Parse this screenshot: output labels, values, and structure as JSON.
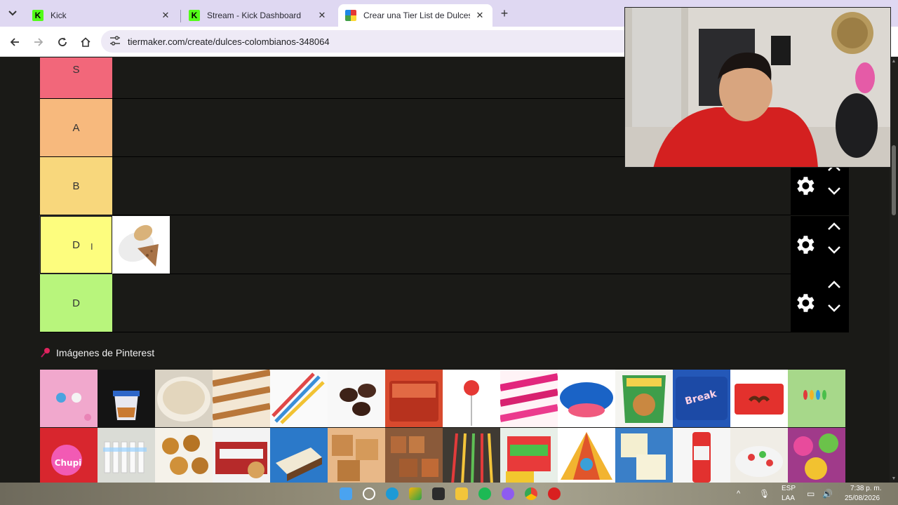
{
  "browser": {
    "tabs": [
      {
        "title": "Kick",
        "favicon": "kick-icon",
        "active": false
      },
      {
        "title": "Stream - Kick Dashboard",
        "favicon": "kick-icon",
        "active": false
      },
      {
        "title": "Crear una Tier List de Dulces co",
        "favicon": "tiermaker-icon",
        "active": true
      }
    ],
    "url": "tiermaker.com/create/dulces-colombianos-348064"
  },
  "tiers": [
    {
      "label": "S",
      "color": "#f2677a"
    },
    {
      "label": "A",
      "color": "#f7b97d"
    },
    {
      "label": "B",
      "color": "#f8d77c"
    },
    {
      "label": "D",
      "color": "#fdfd7e",
      "selected": true
    },
    {
      "label": "D",
      "color": "#b8f57c"
    }
  ],
  "pinterest_section": {
    "title": "Imágenes de Pinterest"
  },
  "taskbar": {
    "language": "ESP",
    "language_sub": "LAA",
    "time": "7:38 p. m.",
    "date": "25/08/2026"
  }
}
